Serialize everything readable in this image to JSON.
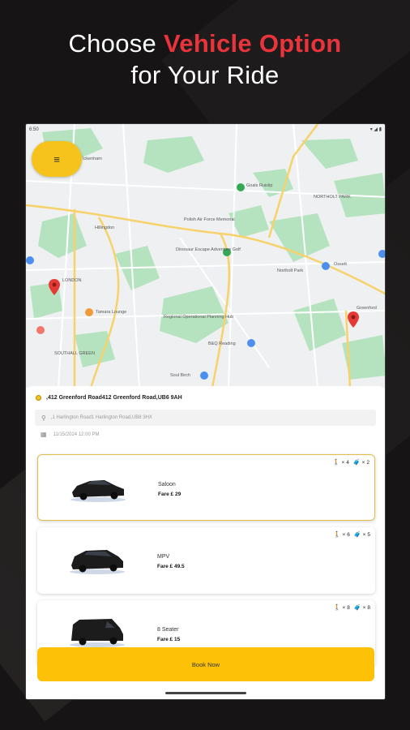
{
  "headline": {
    "line1_prefix": "Choose ",
    "line1_accent": "Vehicle Option",
    "line2": "for Your Ride"
  },
  "statusbar": {
    "time": "6:50",
    "icons": "▾ ◢ ▮"
  },
  "map": {
    "labels": [
      "Goals Ruislip",
      "NORTHOLT PARK",
      "Polish Air Force Memorial",
      "Dinosaur Escape Adventure Golf",
      "Northolt Park",
      "Ossett",
      "LONDON",
      "Tamara Lounge",
      "Greenford",
      "Regional Operational Planning Hub",
      "B&Q Reading",
      "SOUTHALL GREEN",
      "Soul Birch",
      "Ickenham",
      "Hillingdon"
    ]
  },
  "menu_icon": "≡",
  "booking": {
    "pickup": ",412 Greenford Road412 Greenford Road,UB6 9AH",
    "dropoff_placeholder": ",1 Harlington Road1 Harlington Road,UB8 3HX",
    "datetime": "11/15/2024 12:00 PM"
  },
  "vehicles": [
    {
      "name": "Saloon",
      "fare": "Fare £ 29",
      "passengers": "4",
      "luggage": "2",
      "selected": true
    },
    {
      "name": "MPV",
      "fare": "Fare £ 49.5",
      "passengers": "6",
      "luggage": "5",
      "selected": false
    },
    {
      "name": "8 Seater",
      "fare": "Fare £ 15",
      "passengers": "8",
      "luggage": "8",
      "selected": false
    }
  ],
  "book_button_label": "Book Now",
  "colors": {
    "accent": "#fdc208",
    "headline_accent": "#e8343a",
    "pin": "#e53935"
  }
}
